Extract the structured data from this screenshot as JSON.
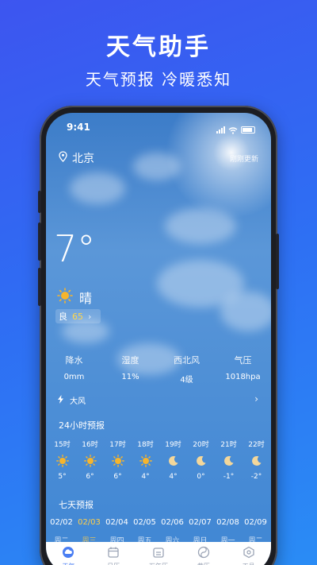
{
  "promo": {
    "title": "天气助手",
    "subtitle": "天气预报  冷暖悉知"
  },
  "status_bar": {
    "time": "9:41"
  },
  "header": {
    "city": "北京",
    "update_text": "刚刚更新"
  },
  "current": {
    "temperature": "7°",
    "condition": "晴",
    "aqi_label": "良",
    "aqi_value": "65"
  },
  "stats": [
    {
      "label": "降水",
      "value": "0mm"
    },
    {
      "label": "湿度",
      "value": "11%"
    },
    {
      "label": "西北风",
      "value": "4级"
    },
    {
      "label": "气压",
      "value": "1018hpa"
    }
  ],
  "alert": {
    "text": "大风"
  },
  "hourly_section": {
    "title": "24小时预报",
    "hours": [
      {
        "time": "15时",
        "icon": "sun-icon",
        "temp": "5°"
      },
      {
        "time": "16时",
        "icon": "sun-icon",
        "temp": "6°"
      },
      {
        "time": "17时",
        "icon": "sun-icon",
        "temp": "6°"
      },
      {
        "time": "18时",
        "icon": "sun-icon",
        "temp": "4°"
      },
      {
        "time": "19时",
        "icon": "moon-icon",
        "temp": "4°"
      },
      {
        "time": "20时",
        "icon": "moon-icon",
        "temp": "0°"
      },
      {
        "time": "21时",
        "icon": "moon-icon",
        "temp": "-1°"
      },
      {
        "time": "22时",
        "icon": "moon-icon",
        "temp": "-2°"
      }
    ]
  },
  "weekly_section": {
    "title": "七天预报",
    "days": [
      "02/02",
      "02/03",
      "02/04",
      "02/05",
      "02/06",
      "02/07",
      "02/08",
      "02/09"
    ],
    "weekdays": [
      "周二",
      "周三",
      "周四",
      "周五",
      "周六",
      "周日",
      "周一",
      "周二"
    ],
    "active_index": 1
  },
  "tabbar": {
    "tabs": [
      {
        "label": "天气",
        "icon": "weather-icon"
      },
      {
        "label": "日历",
        "icon": "calendar-icon"
      },
      {
        "label": "万年历",
        "icon": "almanac-icon"
      },
      {
        "label": "黄历",
        "icon": "yinyang-icon"
      },
      {
        "label": "工具",
        "icon": "tools-icon"
      }
    ],
    "active_index": 0
  },
  "colors": {
    "accent": "#4a7ef3",
    "highlight": "#ffcf4a",
    "sun": "#f7b52c"
  }
}
